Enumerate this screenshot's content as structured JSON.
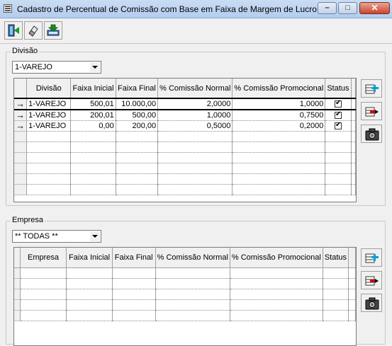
{
  "window": {
    "title": "Cadastro de Percentual de Comissão com Base em Faixa de Margem de Lucro"
  },
  "divisao": {
    "label": "Divisão",
    "combo_value": "1-VAREJO",
    "columns": [
      "Divisão",
      "Faixa Inicial",
      "Faixa Final",
      "% Comissão Normal",
      "% Comissão Promocional",
      "Status"
    ],
    "rows": [
      {
        "divisao": "1-VAREJO",
        "faixa_inicial": "500,01",
        "faixa_final": "10.000,00",
        "com_normal": "2,0000",
        "com_promo": "1,0000",
        "status": true
      },
      {
        "divisao": "1-VAREJO",
        "faixa_inicial": "200,01",
        "faixa_final": "500,00",
        "com_normal": "1,0000",
        "com_promo": "0,7500",
        "status": true
      },
      {
        "divisao": "1-VAREJO",
        "faixa_inicial": "0,00",
        "faixa_final": "200,00",
        "com_normal": "0,5000",
        "com_promo": "0,2000",
        "status": true
      }
    ],
    "empty_rows": 6
  },
  "empresa": {
    "label": "Empresa",
    "combo_value": "** TODAS **",
    "columns": [
      "Empresa",
      "Faixa Inicial",
      "Faixa Final",
      "% Comissão Normal",
      "% Comissão Promocional",
      "Status"
    ],
    "rows": [],
    "empty_rows": 5
  },
  "icons": {
    "toolbar": [
      "exit-door-icon",
      "eraser-icon",
      "save-download-icon"
    ],
    "side": [
      "add-row-icon",
      "remove-row-icon",
      "camera-icon"
    ]
  },
  "colors": {
    "title_bar": "#c9dcf3",
    "close_button": "#c8452f",
    "add_icon": "#00a0d0",
    "remove_icon": "#d00000"
  }
}
